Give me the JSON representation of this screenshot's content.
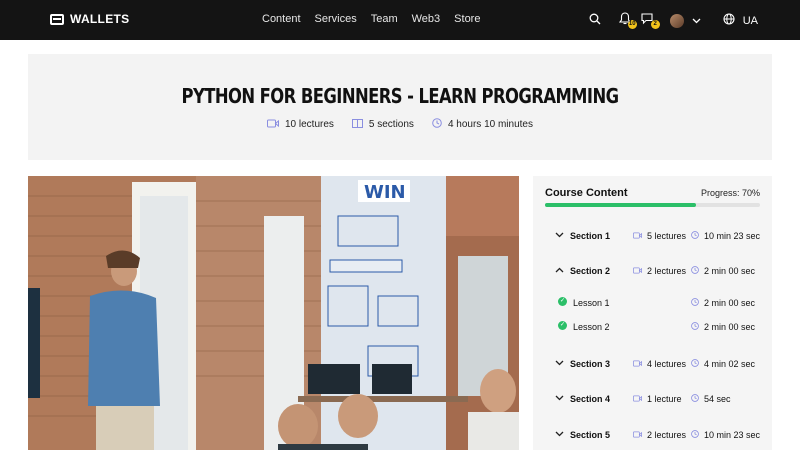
{
  "nav": {
    "logo": "WALLETS",
    "menu": [
      "Content",
      "Services",
      "Team",
      "Web3",
      "Store"
    ],
    "notifications_badge": "10",
    "messages_badge": "2",
    "language": "UA"
  },
  "hero": {
    "title": "PYTHON FOR BEGINNERS - LEARN PROGRAMMING",
    "lectures": "10 lectures",
    "sections": "5 sections",
    "duration": "4 hours 10 minutes"
  },
  "course": {
    "title": "Course Content",
    "progress_label": "Progress: 70%",
    "progress": 0.7,
    "sections": [
      {
        "name": "Section 1",
        "lectures": "5 lectures",
        "duration": "10 min 23 sec"
      },
      {
        "name": "Section 2",
        "lectures": "2 lectures",
        "duration": "2 min 00 sec"
      },
      {
        "name": "Section 3",
        "lectures": "4 lectures",
        "duration": "4 min 02 sec"
      },
      {
        "name": "Section 4",
        "lectures": "1 lecture",
        "duration": "54 sec"
      },
      {
        "name": "Section 5",
        "lectures": "2 lectures",
        "duration": "10 min 23 sec"
      }
    ],
    "lessons": [
      {
        "name": "Lesson 1",
        "duration": "2 min 00 sec"
      },
      {
        "name": "Lesson 2",
        "duration": "2 min 00 sec"
      }
    ]
  },
  "colors": {
    "nav_bg": "#141414",
    "accent": "#8a8ee0",
    "progress": "#2bbf68",
    "badge": "#f2c31b"
  }
}
